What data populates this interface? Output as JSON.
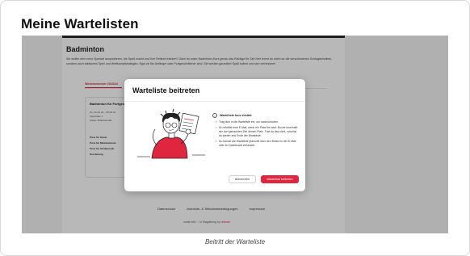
{
  "page": {
    "heading": "Meine Wartelisten",
    "caption": "Beitritt der Warteliste"
  },
  "background": {
    "course_title": "Badminton",
    "description": "Sie wollen eine neue Sportart ausprobieren, die Spaß macht und Ihre Reflexe trainiert? Dann ist unser Badminton-Kurs genau das Richtige für Sie! Hier lernst du nicht nur die verschiedenen Schlagtechniken, sondern auch taktisches Spiel und Wettkampfstrategien. Egal ob Sie Anfänger oder Fortgeschrittener sind, Sie werden garantiert Spaß haben und sich verbessern!",
    "tab_label": "Wintersemester 2023/24",
    "card": {
      "title": "Badminton für Fortgeschrittene",
      "row1": "Do, 01.02.24 – 08.02.24",
      "row2": "Sporthalle 1",
      "row3": "Gäste, Mitarbeitende",
      "prices": [
        "Preis für Gäste",
        "Preis für Mitarbeitende",
        "Preis für Studierende",
        "Kursleitung"
      ]
    },
    "footer": {
      "links": [
        "Datenschutz",
        "Anmelde- & Teilnahmebedingungen",
        "Impressum"
      ],
      "made_prefix": "made with",
      "heart": "♡",
      "made_middle": "in Magdeburg by",
      "brand": "uniman"
    }
  },
  "modal": {
    "title": "Warteliste beitreten",
    "info_icon": "i",
    "info_title": "Warteliste kurz erklärt",
    "items": [
      "Trag dich in die Warteliste ein, um nachzurücken.",
      "Du erhältst eine E-Mail, wenn ein Platz frei wird. Buche innerhalb der dort genannten Zeit deinen Platz. Tust du das nicht, rutschst du wieder ans Ende der Warteliste.",
      "Du kannst die Warteliste jederzeit über den Button in der E-Mail oder im Dashboard verlassen."
    ],
    "cancel_label": "Abbrechen",
    "join_label": "Warteliste beitreten"
  },
  "colors": {
    "accent": "#e0263e",
    "overlay": "rgba(0,0,0,0.28)"
  }
}
